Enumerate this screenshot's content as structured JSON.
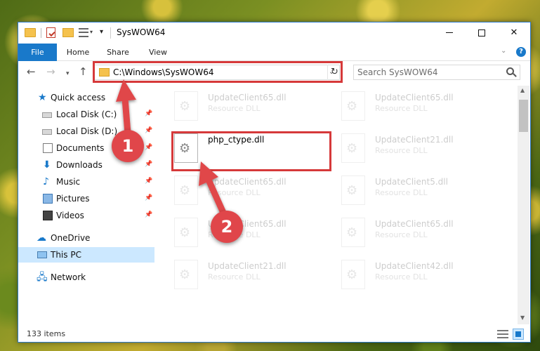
{
  "window": {
    "title": "SysWOW64",
    "buttons": {
      "minimize": "",
      "maximize": "",
      "close": "✕"
    }
  },
  "ribbon": {
    "tabs": [
      "File",
      "Home",
      "Share",
      "View"
    ],
    "help": "?"
  },
  "navigation": {
    "address": "C:\\Windows\\SysWOW64",
    "search_placeholder": "Search SysWOW64"
  },
  "sidebar": {
    "items": [
      {
        "label": "Quick access",
        "icon": "star-icon"
      },
      {
        "label": "Local Disk (C:)",
        "icon": "drive-icon",
        "pinned": true
      },
      {
        "label": "Local Disk (D:)",
        "icon": "drive-icon",
        "pinned": true
      },
      {
        "label": "Documents",
        "icon": "documents-icon",
        "pinned": true
      },
      {
        "label": "Downloads",
        "icon": "download-icon",
        "pinned": true
      },
      {
        "label": "Music",
        "icon": "music-icon",
        "pinned": true
      },
      {
        "label": "Pictures",
        "icon": "pictures-icon",
        "pinned": true
      },
      {
        "label": "Videos",
        "icon": "videos-icon",
        "pinned": true
      },
      {
        "label": "OneDrive",
        "icon": "cloud-icon"
      },
      {
        "label": "This PC",
        "icon": "computer-icon",
        "selected": true
      },
      {
        "label": "Network",
        "icon": "network-icon"
      }
    ]
  },
  "files": {
    "highlighted": {
      "name": "php_ctype.dll"
    },
    "background": [
      {
        "name": "UpdateClient65.dll",
        "type": "Resource DLL"
      },
      {
        "name": "UpdateClient65.dll",
        "type": "Resource DLL"
      },
      {
        "name": "UpdateClient21.dll",
        "type": "Resource DLL"
      },
      {
        "name": "UpdateClient65.dll",
        "type": "Resource DLL"
      },
      {
        "name": "UpdateClient5.dll",
        "type": "Resource DLL"
      },
      {
        "name": "UpdateClient65.dll",
        "type": "Resource DLL"
      },
      {
        "name": "UpdateClient65.dll",
        "type": "Resource DLL"
      },
      {
        "name": "UpdateClient21.dll",
        "type": "Resource DLL"
      },
      {
        "name": "UpdateClient42.dll",
        "type": "Resource DLL"
      }
    ]
  },
  "status": {
    "item_count": "133 items"
  },
  "callouts": {
    "step1": "1",
    "step2": "2"
  },
  "colors": {
    "accent": "#1979ca",
    "highlight": "#d6393a",
    "callout": "#e0464a"
  }
}
